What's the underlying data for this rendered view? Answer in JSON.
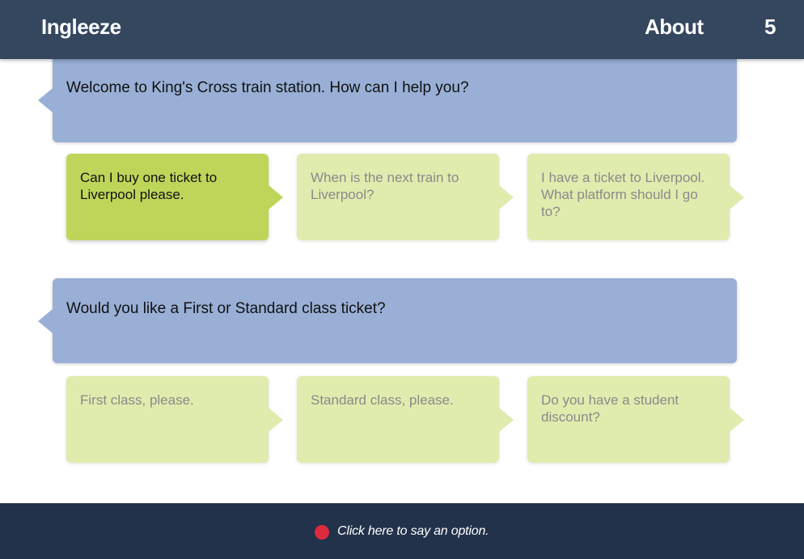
{
  "header": {
    "brand": "Ingleeze",
    "about_label": "About",
    "score": "5"
  },
  "dialogue": [
    {
      "prompt": "Welcome to King's Cross train station. How can I help you?",
      "options": [
        {
          "label": "Can I buy one ticket to Liverpool please.",
          "selected": true
        },
        {
          "label": "When is the next train to Liverpool?",
          "selected": false
        },
        {
          "label": "I have a ticket to Liverpool. What platform should I go to?",
          "selected": false
        }
      ]
    },
    {
      "prompt": "Would you like a First or Standard class ticket?",
      "options": [
        {
          "label": "First class, please.",
          "selected": false
        },
        {
          "label": "Standard class, please.",
          "selected": false
        },
        {
          "label": "Do you have a student discount?",
          "selected": false
        }
      ]
    }
  ],
  "footer": {
    "mic_icon": "record-dot-icon",
    "instruction": "Click here to say an option."
  },
  "colors": {
    "header_bg": "#34475f",
    "footer_bg": "#22324a",
    "prompt_bg": "#99afd6",
    "option_bg": "#e0ebae",
    "option_selected_bg": "#bdd65a",
    "mic_red": "#dc2b3e"
  }
}
